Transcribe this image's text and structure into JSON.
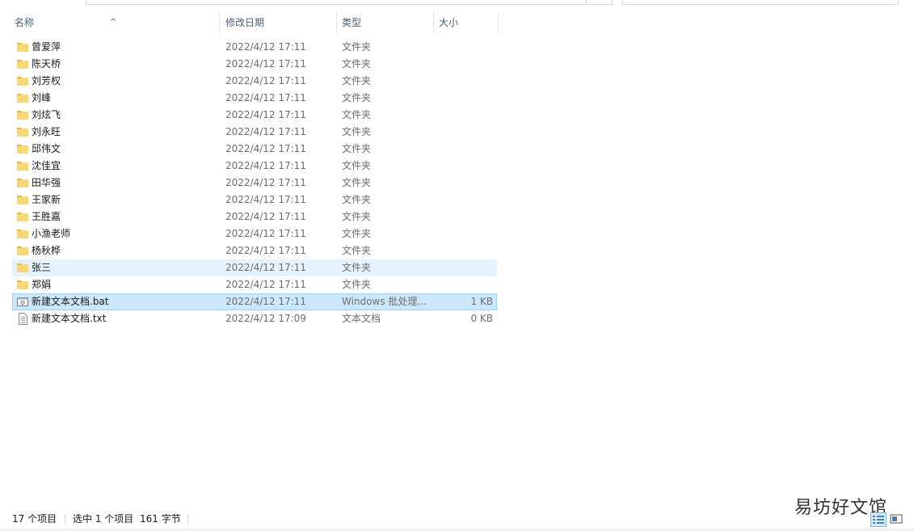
{
  "header": {
    "name": "名称",
    "date": "修改日期",
    "type": "类型",
    "size": "大小",
    "sort_indicator": "^"
  },
  "files": [
    {
      "name": "曾爱萍",
      "date": "2022/4/12 17:11",
      "type": "文件夹",
      "size": "",
      "icon": "folder-icon"
    },
    {
      "name": "陈天桥",
      "date": "2022/4/12 17:11",
      "type": "文件夹",
      "size": "",
      "icon": "folder-icon"
    },
    {
      "name": "刘芳权",
      "date": "2022/4/12 17:11",
      "type": "文件夹",
      "size": "",
      "icon": "folder-icon"
    },
    {
      "name": "刘峰",
      "date": "2022/4/12 17:11",
      "type": "文件夹",
      "size": "",
      "icon": "folder-icon"
    },
    {
      "name": "刘炫飞",
      "date": "2022/4/12 17:11",
      "type": "文件夹",
      "size": "",
      "icon": "folder-icon"
    },
    {
      "name": "刘永旺",
      "date": "2022/4/12 17:11",
      "type": "文件夹",
      "size": "",
      "icon": "folder-icon"
    },
    {
      "name": "邱伟文",
      "date": "2022/4/12 17:11",
      "type": "文件夹",
      "size": "",
      "icon": "folder-icon"
    },
    {
      "name": "沈佳宜",
      "date": "2022/4/12 17:11",
      "type": "文件夹",
      "size": "",
      "icon": "folder-icon"
    },
    {
      "name": "田华强",
      "date": "2022/4/12 17:11",
      "type": "文件夹",
      "size": "",
      "icon": "folder-icon"
    },
    {
      "name": "王家新",
      "date": "2022/4/12 17:11",
      "type": "文件夹",
      "size": "",
      "icon": "folder-icon"
    },
    {
      "name": "王胜嘉",
      "date": "2022/4/12 17:11",
      "type": "文件夹",
      "size": "",
      "icon": "folder-icon"
    },
    {
      "name": "小渔老师",
      "date": "2022/4/12 17:11",
      "type": "文件夹",
      "size": "",
      "icon": "folder-icon"
    },
    {
      "name": "杨秋桦",
      "date": "2022/4/12 17:11",
      "type": "文件夹",
      "size": "",
      "icon": "folder-icon"
    },
    {
      "name": "张三",
      "date": "2022/4/12 17:11",
      "type": "文件夹",
      "size": "",
      "icon": "folder-icon"
    },
    {
      "name": "郑娟",
      "date": "2022/4/12 17:11",
      "type": "文件夹",
      "size": "",
      "icon": "folder-icon"
    },
    {
      "name": "新建文本文档.bat",
      "date": "2022/4/12 17:11",
      "type": "Windows 批处理...",
      "size": "1 KB",
      "icon": "batch-file-icon"
    },
    {
      "name": "新建文本文档.txt",
      "date": "2022/4/12 17:09",
      "type": "文本文档",
      "size": "0 KB",
      "icon": "text-file-icon"
    }
  ],
  "hover_index": 13,
  "selected_index": 15,
  "status": {
    "item_count": "17 个项目",
    "selection": "选中 1 个项目",
    "selection_size": "161 字节"
  },
  "watermark": "易坊好文馆",
  "colors": {
    "hover_bg": "#e5f3ff",
    "selected_bg": "#cce8ff",
    "selected_border": "#99d1ff",
    "folder_yellow": "#f8d775",
    "header_text": "#4c607a"
  }
}
